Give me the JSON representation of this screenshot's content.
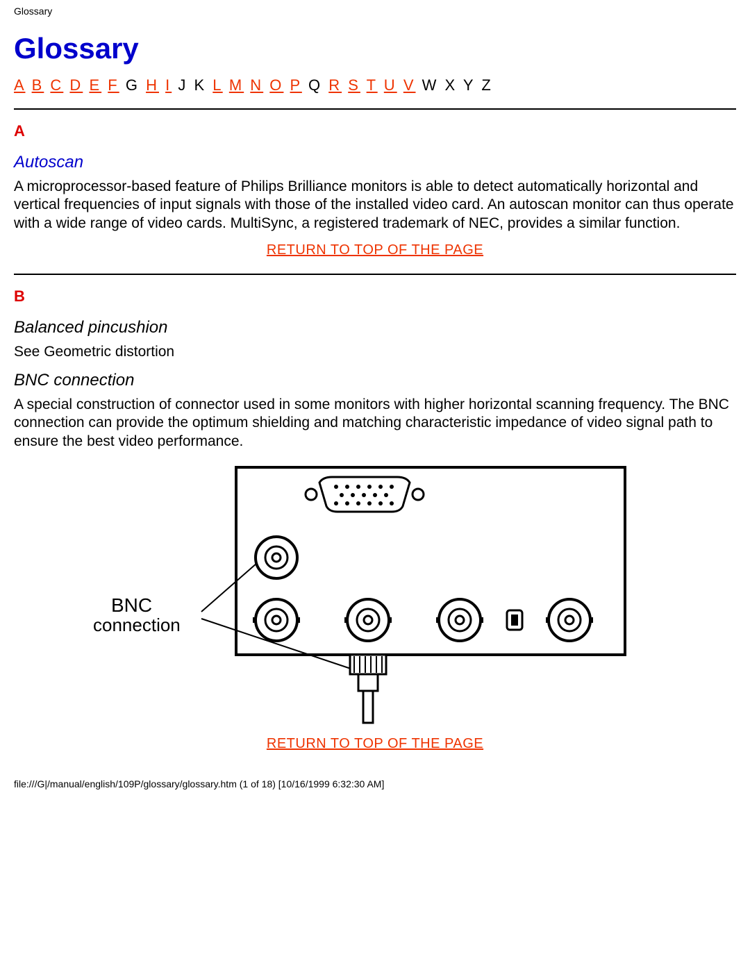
{
  "header": {
    "label": "Glossary"
  },
  "title": "Glossary",
  "alpha": {
    "items": [
      {
        "letter": "A",
        "link": true
      },
      {
        "letter": "B",
        "link": true
      },
      {
        "letter": "C",
        "link": true
      },
      {
        "letter": "D",
        "link": true
      },
      {
        "letter": "E",
        "link": true
      },
      {
        "letter": "F",
        "link": true
      },
      {
        "letter": "G",
        "link": false
      },
      {
        "letter": "H",
        "link": true
      },
      {
        "letter": "I",
        "link": true
      },
      {
        "letter": "J",
        "link": false
      },
      {
        "letter": "K",
        "link": false
      },
      {
        "letter": "L",
        "link": true
      },
      {
        "letter": "M",
        "link": true
      },
      {
        "letter": "N",
        "link": true
      },
      {
        "letter": "O",
        "link": true
      },
      {
        "letter": "P",
        "link": true
      },
      {
        "letter": "Q",
        "link": false
      },
      {
        "letter": "R",
        "link": true
      },
      {
        "letter": "S",
        "link": true
      },
      {
        "letter": "T",
        "link": true
      },
      {
        "letter": "U",
        "link": true
      },
      {
        "letter": "V",
        "link": true
      },
      {
        "letter": "W",
        "link": false
      },
      {
        "letter": "X",
        "link": false
      },
      {
        "letter": "Y",
        "link": false
      },
      {
        "letter": "Z",
        "link": false
      }
    ]
  },
  "sections": {
    "A": {
      "letter": "A",
      "terms": {
        "autoscan": {
          "title": "Autoscan",
          "body": "A microprocessor-based feature of Philips Brilliance monitors is able to detect automatically horizontal and vertical frequencies of input signals with those of the installed video card. An autoscan monitor can thus operate with a wide range of video cards. MultiSync, a registered trademark of NEC, provides a similar function."
        }
      }
    },
    "B": {
      "letter": "B",
      "terms": {
        "balanced_pincushion": {
          "title": "Balanced pincushion",
          "body": "See Geometric distortion"
        },
        "bnc_connection": {
          "title": "BNC connection",
          "body": "A special construction of connector used in some monitors with higher horizontal scanning frequency. The BNC connection can provide the optimum shielding and matching characteristic impedance of video signal path to ensure the best video performance."
        }
      }
    }
  },
  "diagram": {
    "label_line1": "BNC",
    "label_line2": "connection"
  },
  "return_link": "RETURN TO TOP OF THE PAGE",
  "footer": "file:///G|/manual/english/109P/glossary/glossary.htm (1 of 18) [10/16/1999 6:32:30 AM]"
}
